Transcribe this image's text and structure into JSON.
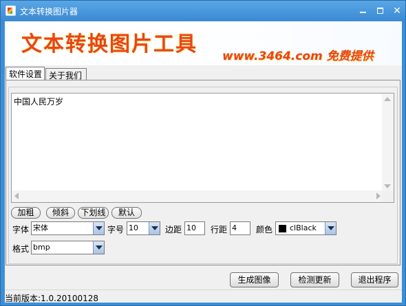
{
  "window": {
    "title": "文本转换图片器"
  },
  "banner": {
    "title": "文本转换图片工具",
    "subtitle": "www.3464.com 免费提供"
  },
  "tabs": [
    {
      "label": "软件设置",
      "active": true
    },
    {
      "label": "关于我们",
      "active": false
    }
  ],
  "editor": {
    "text": "中国人民万岁"
  },
  "style_buttons": {
    "bold": "加粗",
    "italic": "倾斜",
    "underline": "下划线",
    "default": "默认"
  },
  "settings": {
    "font_label": "字体",
    "font_value": "宋体",
    "size_label": "字号",
    "size_value": "10",
    "margin_label": "边距",
    "margin_value": "10",
    "spacing_label": "行距",
    "spacing_value": "4",
    "color_label": "颜色",
    "color_value": "clBlack",
    "color_hex": "#000000",
    "format_label": "格式",
    "format_value": "bmp"
  },
  "actions": {
    "generate": "生成图像",
    "check_update": "检测更新",
    "exit": "退出程序"
  },
  "status": {
    "text": "当前版本:1.0.20100128"
  },
  "colors": {
    "titlebar": "#3a8ad2",
    "banner_text": "#e8451c"
  }
}
